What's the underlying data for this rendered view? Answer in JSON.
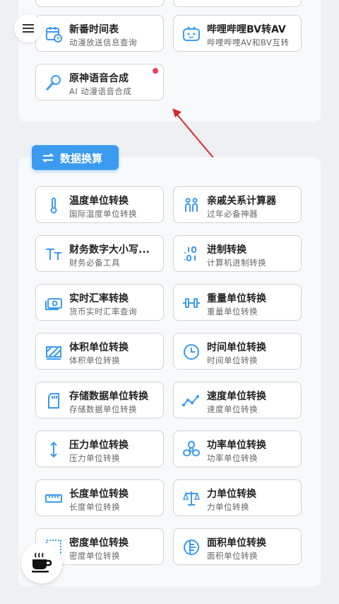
{
  "top_tools": [
    {
      "title": "新番时间表",
      "subtitle": "动漫放送信息查询",
      "icon": "calendar-icon"
    },
    {
      "title": "哔哩哔哩BV转AV",
      "subtitle": "哔哩哔哩AV和BV互转",
      "icon": "tv-icon"
    },
    {
      "title": "原神语音合成",
      "subtitle": "AI 动漫语音合成",
      "icon": "microphone-icon",
      "badge": "new"
    }
  ],
  "section": {
    "title": "数据换算",
    "icon": "convert-icon"
  },
  "data_tools": [
    {
      "title": "温度单位转换",
      "subtitle": "国际温度单位转换",
      "icon": "thermometer-icon"
    },
    {
      "title": "亲戚关系计算器",
      "subtitle": "过年必备神器",
      "icon": "people-icon"
    },
    {
      "title": "财务数字大小写...",
      "subtitle": "财务必备工具",
      "icon": "text-size-icon"
    },
    {
      "title": "进制转换",
      "subtitle": "计算机进制转换",
      "icon": "binary-icon"
    },
    {
      "title": "实时汇率转换",
      "subtitle": "货币实时汇率查询",
      "icon": "money-icon"
    },
    {
      "title": "重量单位转换",
      "subtitle": "重量单位转换",
      "icon": "dumbbell-icon"
    },
    {
      "title": "体积单位转换",
      "subtitle": "体积单位转换",
      "icon": "volume-icon"
    },
    {
      "title": "时间单位转换",
      "subtitle": "时间单位转换",
      "icon": "clock-icon"
    },
    {
      "title": "存储数据单位转换",
      "subtitle": "存储数据单位转换",
      "icon": "sd-card-icon"
    },
    {
      "title": "速度单位转换",
      "subtitle": "速度单位转换",
      "icon": "speed-chart-icon"
    },
    {
      "title": "压力单位转换",
      "subtitle": "压力单位转换",
      "icon": "pressure-arrow-icon"
    },
    {
      "title": "功率单位转换",
      "subtitle": "功率单位转换",
      "icon": "fan-icon"
    },
    {
      "title": "长度单位转换",
      "subtitle": "长度单位转换",
      "icon": "ruler-icon"
    },
    {
      "title": "力单位转换",
      "subtitle": "力单位转换",
      "icon": "scale-icon"
    },
    {
      "title": "密度单位转换",
      "subtitle": "密度单位转换",
      "icon": "density-icon"
    },
    {
      "title": "面积单位转换",
      "subtitle": "面积单位转换",
      "icon": "area-icon"
    }
  ],
  "colors": {
    "accent": "#3a9bf0",
    "badge_dot": "#e8445a",
    "arrow": "#d9262c"
  }
}
